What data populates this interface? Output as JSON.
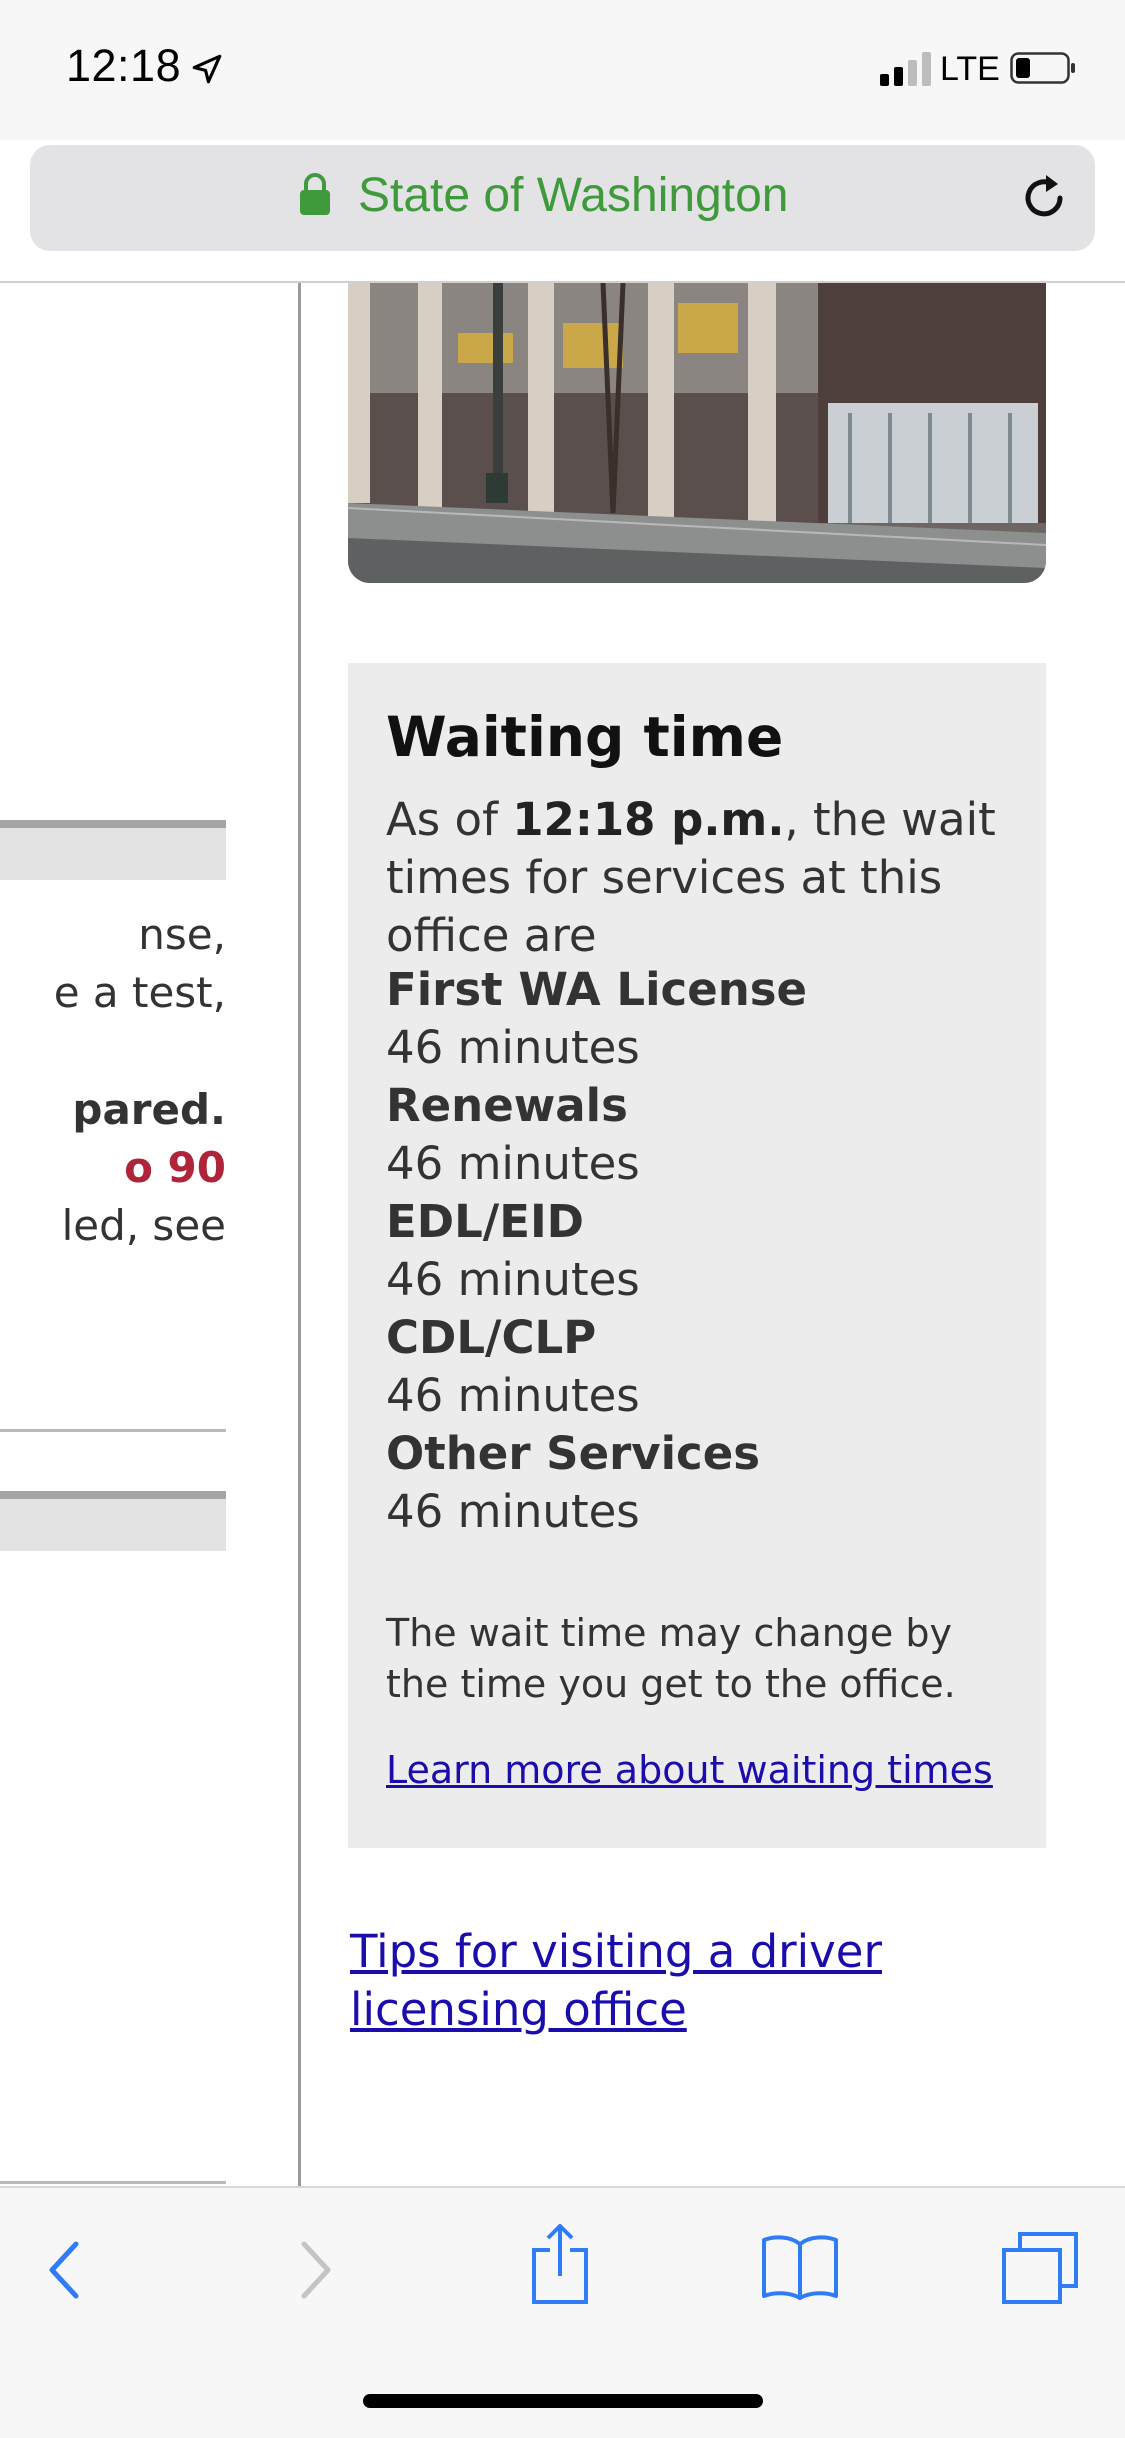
{
  "status_bar": {
    "time": "12:18",
    "network": "LTE"
  },
  "browser": {
    "url_title": "State of Washington"
  },
  "left_column": {
    "snippets": [
      "nse,",
      "e a test,",
      "pared.",
      "o 90",
      "led, see"
    ]
  },
  "waiting": {
    "title": "Waiting time",
    "intro_prefix": "As of ",
    "time": "12:18 p.m.",
    "intro_suffix": ", the wait times for services at this office are",
    "services": [
      {
        "name": "First WA License",
        "wait": "46 minutes"
      },
      {
        "name": "Renewals",
        "wait": "46 minutes"
      },
      {
        "name": "EDL/EID",
        "wait": "46 minutes"
      },
      {
        "name": "CDL/CLP",
        "wait": "46 minutes"
      },
      {
        "name": "Other Services",
        "wait": "46 minutes"
      }
    ],
    "note": "The wait time may change by the time you get to the office.",
    "learn_more": "Learn more about waiting times"
  },
  "tips_link": "Tips for visiting a driver licensing office",
  "colors": {
    "url_green": "#3f9a3c",
    "link_blue": "#1a0dab",
    "accent_red": "#b0243a",
    "toolbar_blue": "#2f7cf6"
  }
}
